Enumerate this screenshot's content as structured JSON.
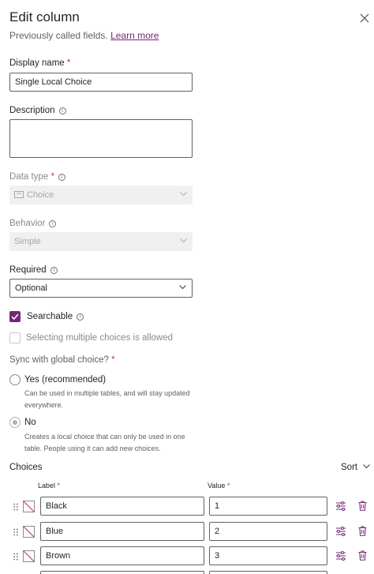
{
  "header": {
    "title": "Edit column",
    "subtitle": "Previously called fields.",
    "learn_more": "Learn more"
  },
  "display_name": {
    "label": "Display name",
    "required_mark": "*",
    "value": "Single Local Choice"
  },
  "description": {
    "label": "Description",
    "value": ""
  },
  "data_type": {
    "label": "Data type",
    "required_mark": "*",
    "value": "Choice"
  },
  "behavior": {
    "label": "Behavior",
    "value": "Simple"
  },
  "required": {
    "label": "Required",
    "value": "Optional"
  },
  "searchable": {
    "label": "Searchable",
    "checked": true
  },
  "multiple_choices": {
    "label": "Selecting multiple choices is allowed",
    "checked": false
  },
  "sync_global": {
    "label": "Sync with global choice?",
    "required_mark": "*",
    "options": [
      {
        "label": "Yes (recommended)",
        "desc_line1": "Can be used in multiple tables, and will stay updated",
        "desc_line2": "everywhere.",
        "selected": false
      },
      {
        "label": "No",
        "desc_line1": "Creates a local choice that can only be used in one",
        "desc_line2": "table. People using it can add new choices.",
        "selected": true
      }
    ]
  },
  "choices": {
    "title": "Choices",
    "sort_label": "Sort",
    "label_header": "Label",
    "value_header": "Value",
    "required_mark": "*",
    "rows": [
      {
        "label": "Black",
        "value": "1"
      },
      {
        "label": "Blue",
        "value": "2"
      },
      {
        "label": "Brown",
        "value": "3"
      }
    ]
  },
  "colors": {
    "accent": "#742774",
    "delete": "#742774"
  }
}
